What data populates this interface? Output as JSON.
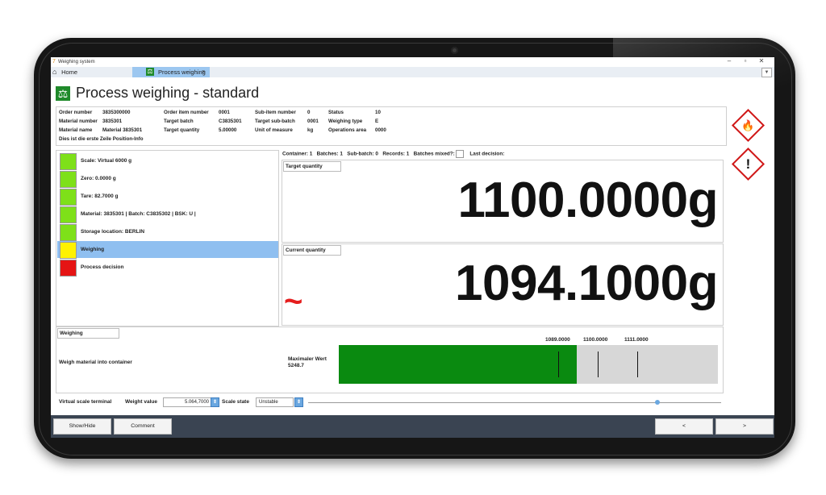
{
  "window": {
    "app_title": "Weighing system",
    "controls": [
      "–",
      "▫",
      "✕"
    ]
  },
  "tabs": {
    "home_label": "Home",
    "active_label": "Process weighing",
    "close": "×",
    "dropdown": "▼"
  },
  "page": {
    "title": "Process weighing - standard"
  },
  "info": {
    "order_number_label": "Order number",
    "order_number": "3835300000",
    "order_item_label": "Order item number",
    "order_item": "0001",
    "sub_item_label": "Sub-item number",
    "sub_item": "0",
    "status_label": "Status",
    "status": "10",
    "material_number_label": "Material number",
    "material_number": "3835301",
    "target_batch_label": "Target batch",
    "target_batch": "C3835301",
    "target_sub_batch_label": "Target sub-batch",
    "target_sub_batch": "0001",
    "weighing_type_label": "Weighing type",
    "weighing_type": "E",
    "material_name_label": "Material name",
    "material_name": "Material 3835301",
    "target_quantity_label": "Target quantity",
    "target_quantity": "5.00000",
    "unit_label": "Unit of measure",
    "unit": "kg",
    "operations_area_label": "Operations area",
    "operations_area": "0000",
    "position_info": "Dies ist die erste Zeile Position-Info"
  },
  "hazards": [
    {
      "icon": "flame-icon",
      "glyph": "🔥"
    },
    {
      "icon": "exclamation-icon",
      "glyph": "!"
    }
  ],
  "steps": [
    {
      "label": "Scale: Virtual 6000 g",
      "color": "#7ee019"
    },
    {
      "label": "Zero: 0.0000 g",
      "color": "#7ee019"
    },
    {
      "label": "Tare: 82.7000 g",
      "color": "#7ee019"
    },
    {
      "label": "Material: 3835301 | Batch: C3835302 | BSK: U |",
      "color": "#7ee019"
    },
    {
      "label": "Storage location: BERLIN",
      "color": "#7ee019"
    },
    {
      "label": "Weighing",
      "color": "#fff200"
    },
    {
      "label": "Process decision",
      "color": "#e51414"
    }
  ],
  "stats": {
    "container": "Container: 1",
    "batches": "Batches: 1",
    "sub_batch": "Sub-batch: 0",
    "records": "Records: 1",
    "batches_mixed": "Batches mixed?:",
    "last_decision": "Last decision:"
  },
  "target": {
    "label": "Target quantity",
    "value": "1100.0000g"
  },
  "current": {
    "label": "Current quantity",
    "value": "1094.1000g",
    "unstable_symbol": "~"
  },
  "weighing": {
    "title": "Weighing",
    "instruction": "Weigh material into container",
    "max_label": "Maximaler Wert",
    "max_value": "5248.7",
    "ticks": [
      "1089.0000",
      "1100.0000",
      "1111.0000"
    ],
    "fill_fraction": 0.628
  },
  "vst": {
    "label": "Virtual scale terminal",
    "weight_label": "Weight value",
    "weight_value": "5.064,7000",
    "state_label": "Scale state",
    "state_value": "Unstable",
    "slider_fraction": 0.84
  },
  "footer": {
    "show_hide": "Show/Hide",
    "comment": "Comment",
    "prev": "<",
    "next": ">"
  }
}
